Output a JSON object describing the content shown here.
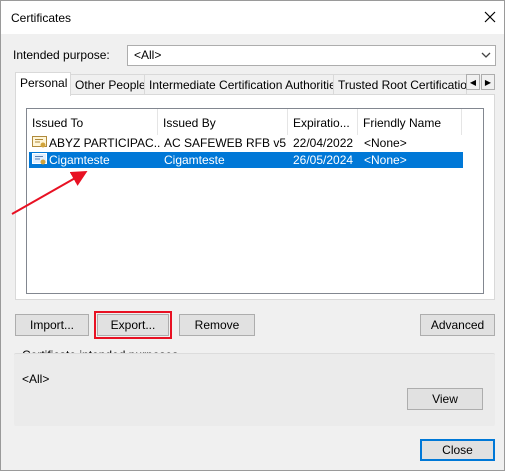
{
  "window": {
    "title": "Certificates"
  },
  "intended_purpose": {
    "label": "Intended purpose:",
    "value": "<All>"
  },
  "tabs": [
    {
      "label": "Personal",
      "active": true
    },
    {
      "label": "Other People",
      "active": false
    },
    {
      "label": "Intermediate Certification Authorities",
      "active": false
    },
    {
      "label": "Trusted Root Certification Authorities",
      "active": false
    }
  ],
  "columns": [
    "Issued To",
    "Issued By",
    "Expiratio...",
    "Friendly Name"
  ],
  "certificates": [
    {
      "issued_to": "ABYZ PARTICIPAC...",
      "issued_by": "AC SAFEWEB RFB v5",
      "expiration": "22/04/2022",
      "friendly_name": "<None>",
      "selected": false
    },
    {
      "issued_to": "Cigamteste",
      "issued_by": "Cigamteste",
      "expiration": "26/05/2024",
      "friendly_name": "<None>",
      "selected": true
    }
  ],
  "buttons": {
    "import": "Import...",
    "export": "Export...",
    "remove": "Remove",
    "advanced": "Advanced",
    "view": "View",
    "close": "Close"
  },
  "purposes_group": {
    "label": "Certificate intended purposes",
    "value": "<All>"
  },
  "colors": {
    "selection": "#0078d7",
    "highlight": "#e81123",
    "annotation_arrow": "#e81123"
  }
}
